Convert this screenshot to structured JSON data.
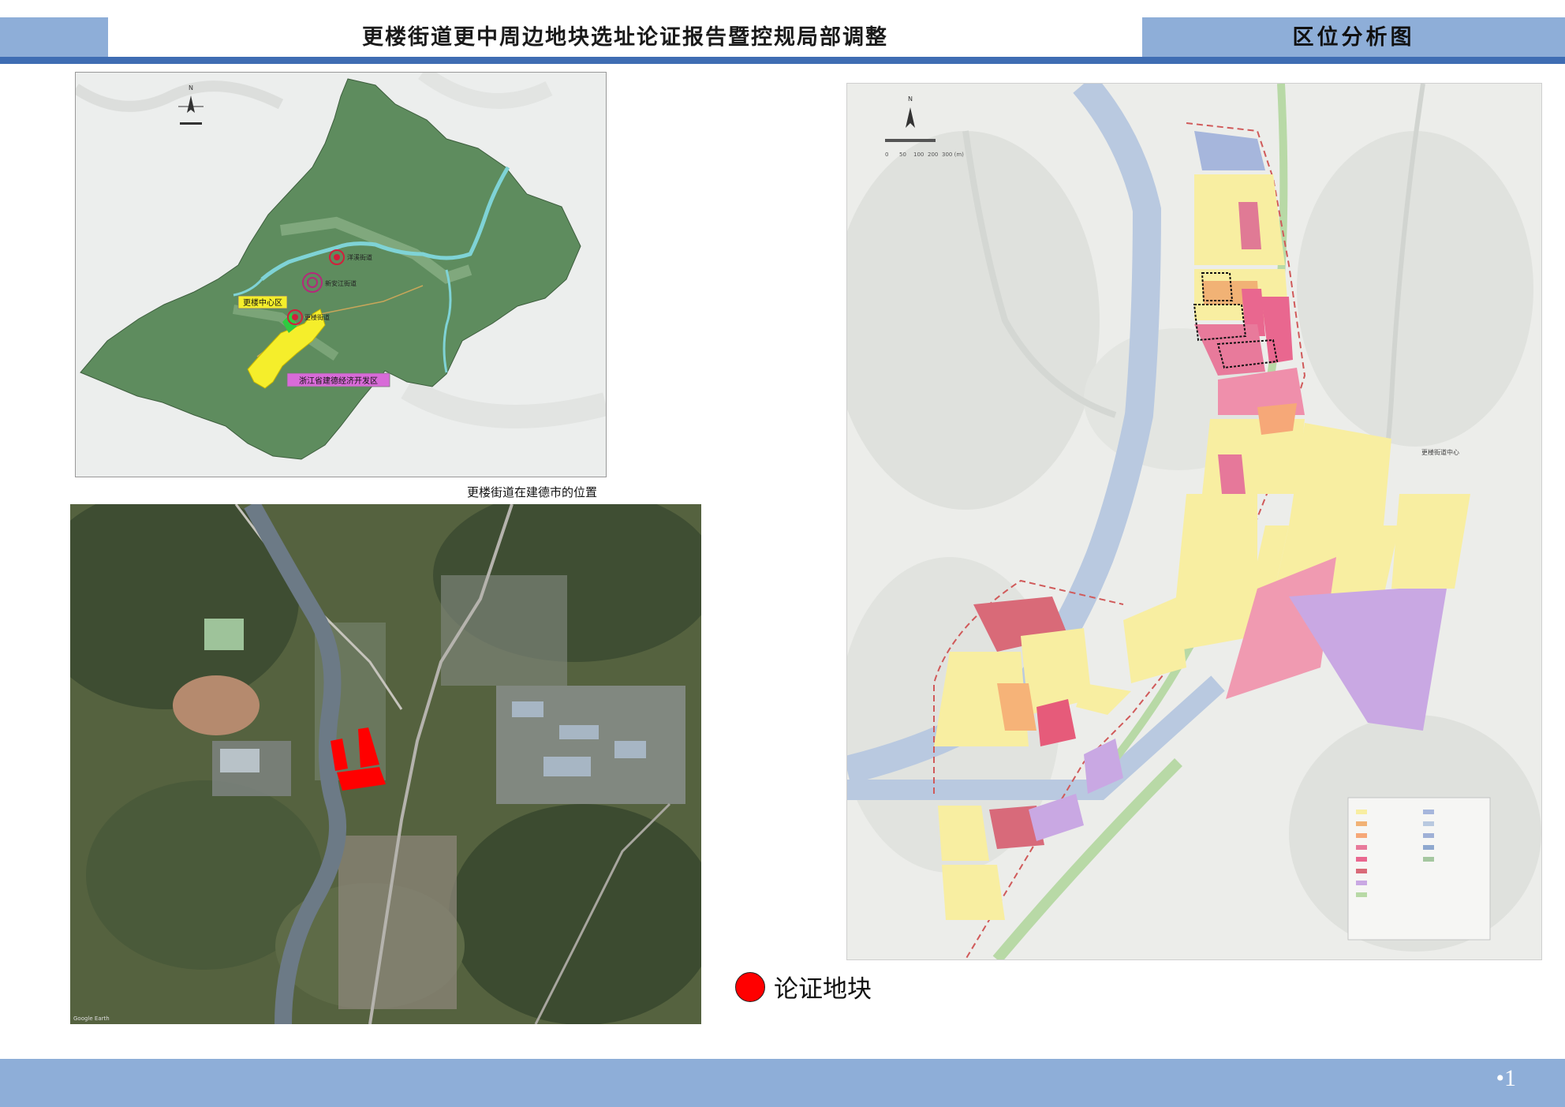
{
  "header": {
    "title": "更楼街道更中周边地块选址论证报告暨控规局部调整",
    "section": "区位分析图"
  },
  "map1": {
    "caption": "更楼街道在建德市的位置",
    "labels": {
      "town_a": "洋溪街道",
      "town_b": "新安江街道",
      "town_c": "更楼街道",
      "center": "更楼中心区",
      "devzone": "浙江省建德经济开发区"
    },
    "north": "N"
  },
  "map2": {
    "watermark": "Google Earth"
  },
  "map3": {
    "north": "N",
    "scale": [
      "0",
      "50",
      "100",
      "200",
      "300 (m)"
    ],
    "center_label": "更楼街道中心"
  },
  "legend": {
    "site_label": "论证地块"
  },
  "footer": {
    "page": "•1"
  },
  "colors": {
    "header_bar": "#8eaed8",
    "header_line": "#3f6db3",
    "site": "#ff0000"
  }
}
